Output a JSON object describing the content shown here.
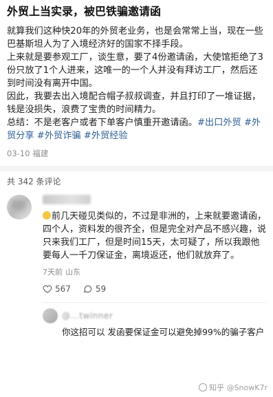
{
  "post": {
    "title": "外贸上当实录，被巴铁骗邀请函",
    "paragraphs": [
      "就算我们这种快20年的外贸老业务，也是会常常上当，现在一些巴基斯坦人为了入境经济好的国家不择手段。",
      "上来就是要参观工厂，谈生意，要了4份邀请函，大使馆拒绝了3份只放了1个人进来，这唯一的一个人并没有拜访工厂，然后还到时间没有离开中国。",
      "因此，我要去出入境配合帽子叔叔调查，并且打印了一堆证据，钱是没损失，浪费了宝贵的时间精力。"
    ],
    "summary": "总结：不是老客户或者下单客户慎重开邀请函。",
    "hashtags": [
      "#出口外贸",
      "#外贸分享",
      "#外贸诈骗",
      "#外贸经验"
    ],
    "date": "03-10",
    "location": "福建"
  },
  "comments_header": "共 342 条评论",
  "comment": {
    "text": "前几天碰见类似的，不过是非洲的，上来就要邀请函，四个人，资料发的很齐全，但是完全对产品不感兴趣，说只来我们工厂，但是时间15天，太可疑了，所以我跟他要每人一千刀保证金，离境返还，他们就放弃了。",
    "time": "7天前",
    "location": "山东",
    "likes": "567",
    "replies": "59",
    "reply": {
      "author": "@...twinner",
      "text": "你这招可以 发函要保证金可以避免掉99%的骗子客户"
    }
  },
  "watermark": "知乎 @SnowK7r",
  "colors": {
    "hashtag": "#2e5f96",
    "meta": "#8c8c8c"
  },
  "icons": [
    "heart-icon",
    "comment-icon",
    "zhihu-logo-icon"
  ]
}
